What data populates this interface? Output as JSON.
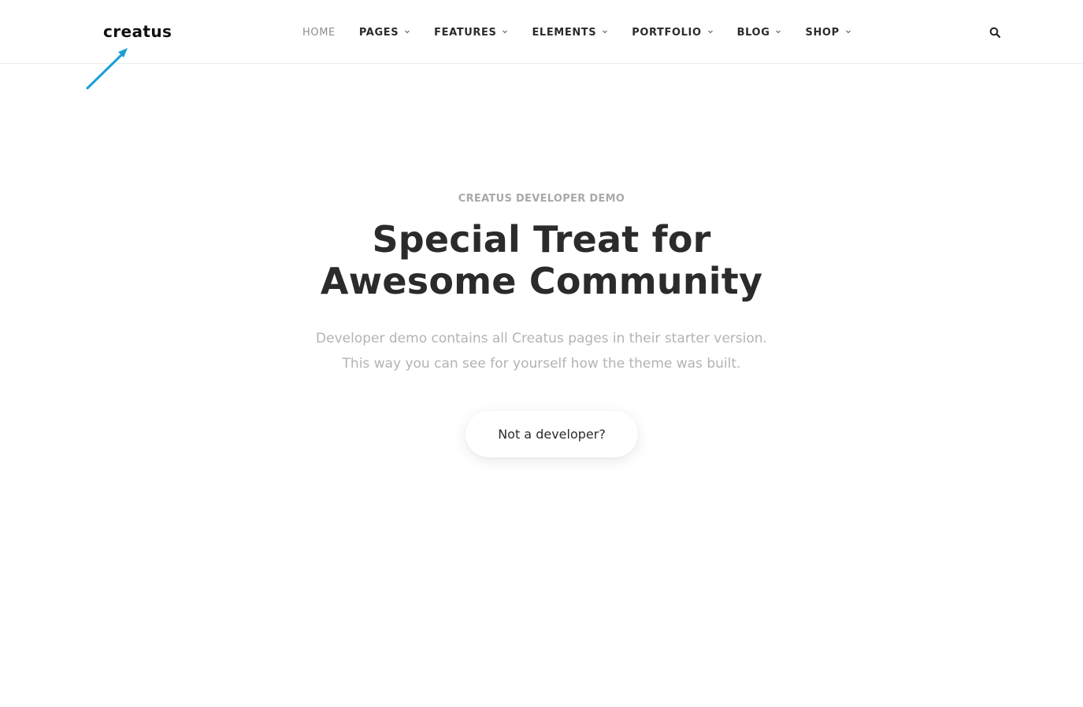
{
  "header": {
    "logo_text": "creatus",
    "nav": [
      {
        "label": "HOME",
        "active": true,
        "has_dropdown": false
      },
      {
        "label": "PAGES",
        "active": false,
        "has_dropdown": true
      },
      {
        "label": "FEATURES",
        "active": false,
        "has_dropdown": true
      },
      {
        "label": "ELEMENTS",
        "active": false,
        "has_dropdown": true
      },
      {
        "label": "PORTFOLIO",
        "active": false,
        "has_dropdown": true
      },
      {
        "label": "BLOG",
        "active": false,
        "has_dropdown": true
      },
      {
        "label": "SHOP",
        "active": false,
        "has_dropdown": true
      }
    ],
    "search_icon": "search-icon"
  },
  "annotation": {
    "icon": "arrow-icon",
    "color": "#1a9fd9"
  },
  "hero": {
    "eyebrow": "CREATUS DEVELOPER DEMO",
    "headline_line1": "Special Treat for",
    "headline_line2": "Awesome Community",
    "lead_line1": "Developer demo contains all Creatus pages in their starter version.",
    "lead_line2": "This way you can see for yourself how the theme was built.",
    "cta_label": "Not a developer?"
  },
  "colors": {
    "text_dark": "#2b2b2b",
    "text_muted": "#b3b3b3",
    "nav_active": "#8d8d8d",
    "arrow": "#1a9fd9"
  }
}
